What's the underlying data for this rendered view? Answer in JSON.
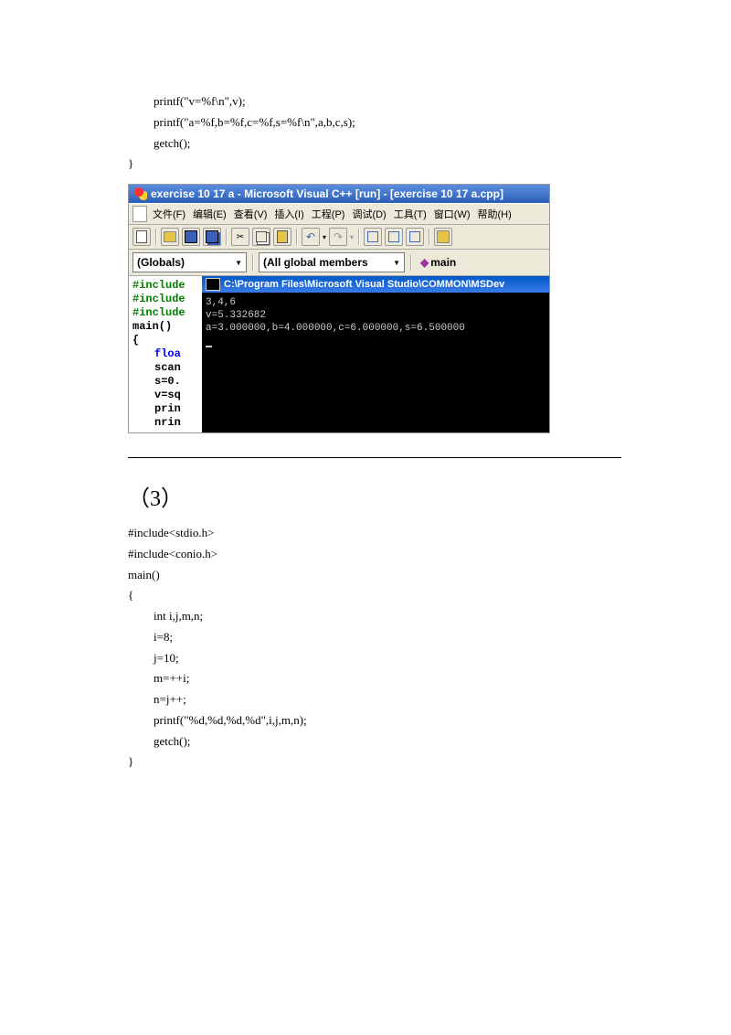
{
  "top_code": {
    "l1": "printf(\"v=%f\\n\",v);",
    "l2": "printf(\"a=%f,b=%f,c=%f,s=%f\\n\",a,b,c,s);",
    "l3": "getch();",
    "l4": "}"
  },
  "ide": {
    "title": "exercise 10 17 a - Microsoft Visual C++ [run] - [exercise 10 17 a.cpp]",
    "menu": {
      "file": "文件(F)",
      "edit": "编辑(E)",
      "view": "查看(V)",
      "insert": "插入(I)",
      "project": "工程(P)",
      "debug": "调试(D)",
      "tools": "工具(T)",
      "window": "窗口(W)",
      "help": "帮助(H)"
    },
    "dropdown": {
      "globals": "(Globals)",
      "members": "(All global members",
      "main": "main"
    },
    "editor": {
      "l1": "#include",
      "l2": "#include",
      "l3": "#include",
      "l4": "main()",
      "l5": "{",
      "l6a": "floa",
      "l7": "scan",
      "l8": "s=0.",
      "l9": "v=sq",
      "l10": "prin",
      "l11": "nrin"
    },
    "console": {
      "title": "C:\\Program Files\\Microsoft Visual Studio\\COMMON\\MSDev",
      "o1": "3,4,6",
      "o2": "v=5.332682",
      "o3": "a=3.000000,b=4.000000,c=6.000000,s=6.500000"
    }
  },
  "section_label": "（3）",
  "bottom_code": {
    "l1": "#include<stdio.h>",
    "l2": "#include<conio.h>",
    "l3": "main()",
    "l4": "{",
    "l5": "int i,j,m,n;",
    "l6": "i=8;",
    "l7": "j=10;",
    "l8": "m=++i;",
    "l9": "n=j++;",
    "l10": "printf(\"%d,%d,%d,%d\",i,j,m,n);",
    "l11": "getch();",
    "l12": "}"
  }
}
